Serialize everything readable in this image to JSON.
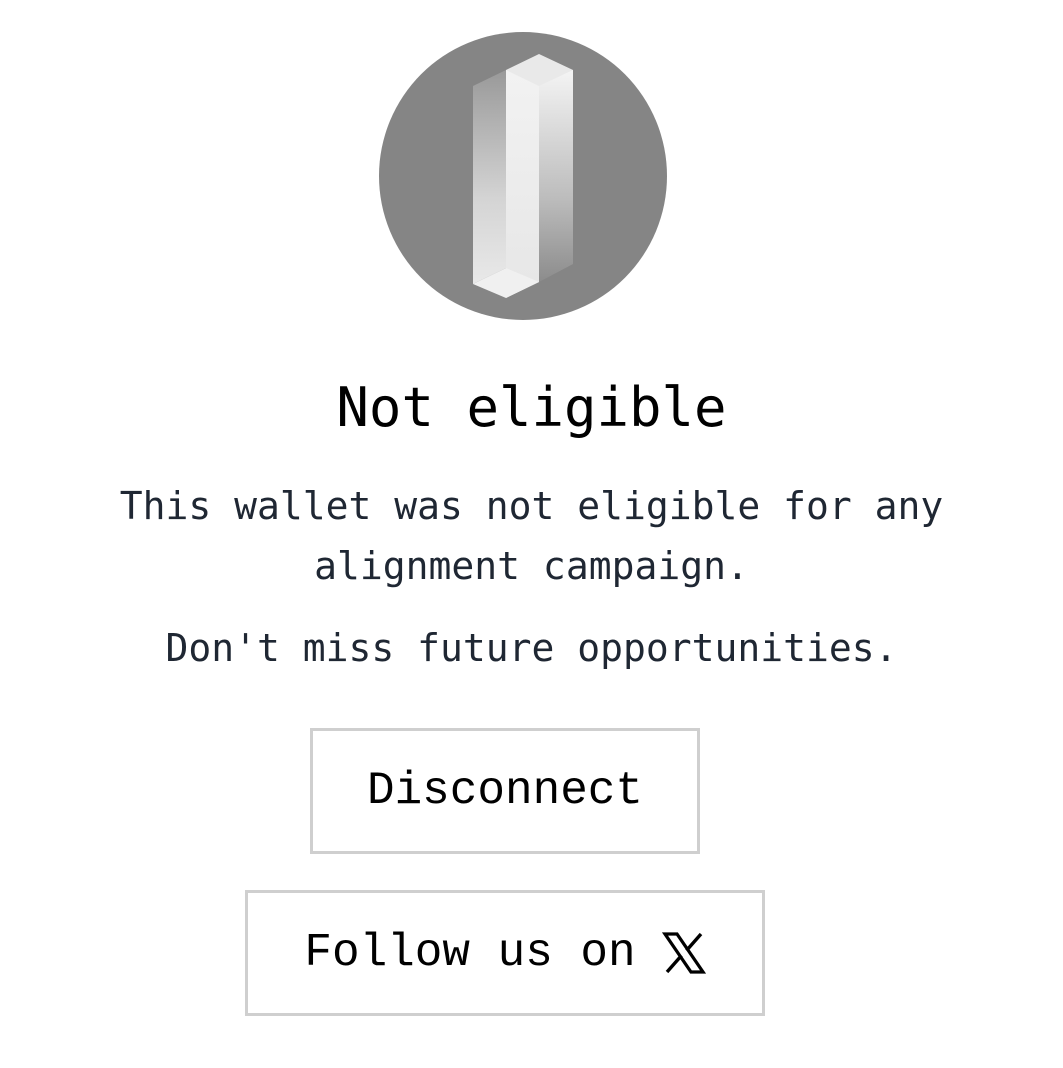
{
  "status": {
    "title": "Not eligible",
    "description": "This wallet was not eligible for any alignment campaign.",
    "cta_text": "Don't miss future opportunities."
  },
  "actions": {
    "disconnect_label": "Disconnect",
    "follow_label": "Follow us on"
  },
  "icons": {
    "logo": "pillar-logo-icon",
    "social": "x-logo-icon"
  },
  "colors": {
    "logo_circle": "#858585",
    "title_text": "#000000",
    "body_text": "#1f2733",
    "button_border": "#cfcfcf"
  }
}
